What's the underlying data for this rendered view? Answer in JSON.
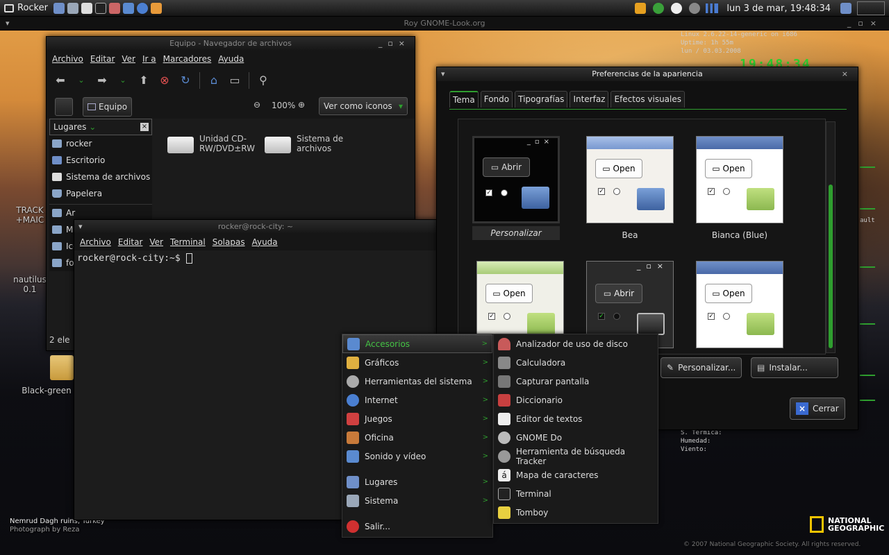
{
  "panel": {
    "app_menu": "Rocker",
    "clock": "lun  3 de mar, 19:48:34"
  },
  "title_strip": "Roy GNOME-Look.org",
  "conky": {
    "line1": "Linux 2.6.22-14-generic on i686",
    "line2": "Uptime: 1h 55m",
    "line3": "lun / 03.03.2008",
    "time": "19:48:34",
    "weather1": "S. Termica:",
    "weather2": "Humedad:",
    "weather3": "Viento:",
    "fault": "ault"
  },
  "desktop": {
    "track_label": "TRACK\n+MAIC",
    "nautilus_label": "nautilus\n0.1",
    "folder_label": "Black-green",
    "caption1": "Nemrud Dagh ruins, Turkey",
    "caption2": "Photograph by Reza",
    "copyright": "© 2007 National Geographic Society. All rights reserved.",
    "ng_logo": "NATIONAL\nGEOGRAPHIC"
  },
  "file_manager": {
    "title": "Equipo - Navegador de archivos",
    "menu": [
      "Archivo",
      "Editar",
      "Ver",
      "Ir a",
      "Marcadores",
      "Ayuda"
    ],
    "location_button": "Equipo",
    "zoom": "100%",
    "view_mode": "Ver como iconos",
    "sidebar_title": "Lugares",
    "sidebar_items": [
      "rocker",
      "Escritorio",
      "Sistema de archivos",
      "Papelera",
      "Ar",
      "My",
      "Ice",
      "fo"
    ],
    "files": [
      {
        "name": "Unidad CD-RW/DVD±RW"
      },
      {
        "name": "Sistema de archivos"
      }
    ],
    "status": "2 ele"
  },
  "terminal": {
    "title": "rocker@rock-city: ~",
    "menu": [
      "Archivo",
      "Editar",
      "Ver",
      "Terminal",
      "Solapas",
      "Ayuda"
    ],
    "prompt": "rocker@rock-city:~$"
  },
  "appearance": {
    "title": "Preferencias de la apariencia",
    "tabs": [
      "Tema",
      "Fondo",
      "Tipografías",
      "Interfaz",
      "Efectos visuales"
    ],
    "themes": [
      {
        "name": "Personalizar",
        "button": "Abrir"
      },
      {
        "name": "Bea",
        "button": "Open"
      },
      {
        "name": "Bianca (Blue)",
        "button": "Open"
      },
      {
        "name": "",
        "button": "Open"
      },
      {
        "name": "",
        "button": "Abrir"
      },
      {
        "name": "",
        "button": "Open"
      }
    ],
    "customize_button": "Personalizar...",
    "install_button": "Instalar...",
    "close_button": "Cerrar"
  },
  "main_menu": {
    "categories": [
      "Accesorios",
      "Gráficos",
      "Herramientas del sistema",
      "Internet",
      "Juegos",
      "Oficina",
      "Sonido y vídeo"
    ],
    "places": "Lugares",
    "system": "Sistema",
    "logout": "Salir..."
  },
  "accessories_menu": {
    "items": [
      "Analizador de uso de disco",
      "Calculadora",
      "Capturar pantalla",
      "Diccionario",
      "Editor de textos",
      "GNOME Do",
      "Herramienta de búsqueda Tracker",
      "Mapa de caracteres",
      "Terminal",
      "Tomboy"
    ]
  },
  "colors": {
    "accent_green": "#2f9e2f",
    "panel_dark": "#151515"
  }
}
